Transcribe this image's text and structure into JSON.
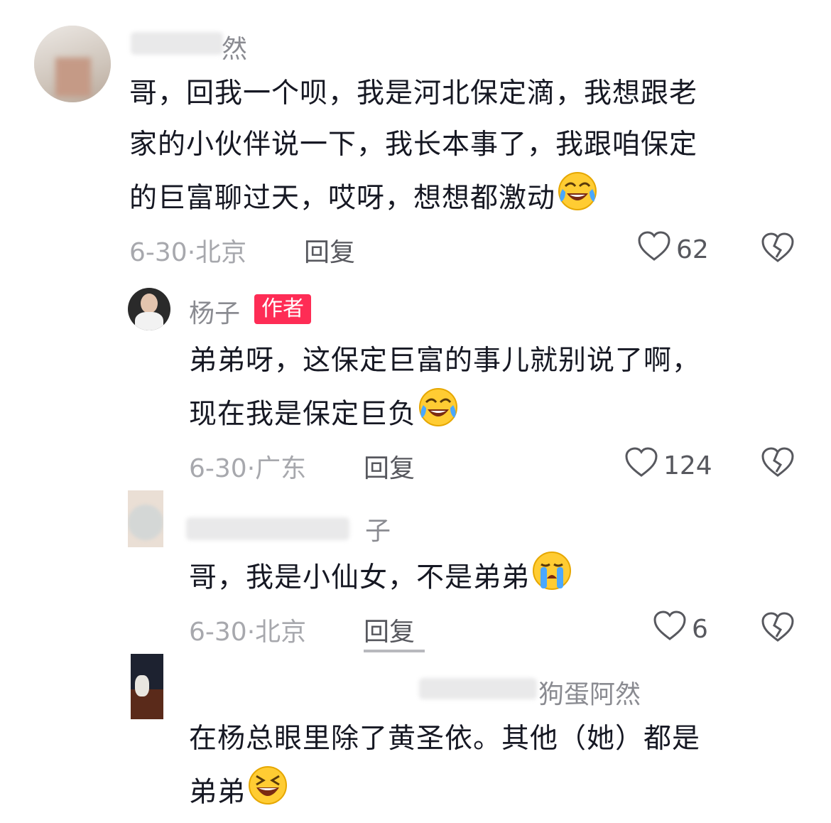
{
  "comments": [
    {
      "username": "然",
      "text_lines": [
        "哥，回我一个呗，我是河北保定滴，我想跟老",
        "家的小伙伴说一下，我长本事了，我跟咱保定",
        "的巨富聊过天，哎呀，想想都激动"
      ],
      "date": "6-30",
      "location": "北京",
      "reply_label": "回复",
      "likes": "62"
    },
    {
      "username": "杨子",
      "author_badge": "作者",
      "text_lines": [
        "弟弟呀，这保定巨富的事儿就别说了啊，",
        "现在我是保定巨负"
      ],
      "date": "6-30",
      "location": "广东",
      "reply_label": "回复",
      "likes": "124"
    },
    {
      "username": "子",
      "text_lines": [
        "哥，我是小仙女，不是弟弟"
      ],
      "date": "6-30",
      "location": "北京",
      "reply_label": "回复",
      "likes": "6"
    },
    {
      "username": "狗蛋阿然",
      "text_lines": [
        "在杨总眼里除了黄圣依。其他（她）都是",
        "弟弟"
      ]
    }
  ],
  "separator": "·",
  "icons": {
    "like": "heart-outline-icon",
    "dislike": "broken-heart-icon",
    "emoji_laugh_cry": "rolling-laughing-emoji",
    "emoji_cry": "loudly-crying-emoji",
    "emoji_grin": "grinning-squint-emoji"
  }
}
